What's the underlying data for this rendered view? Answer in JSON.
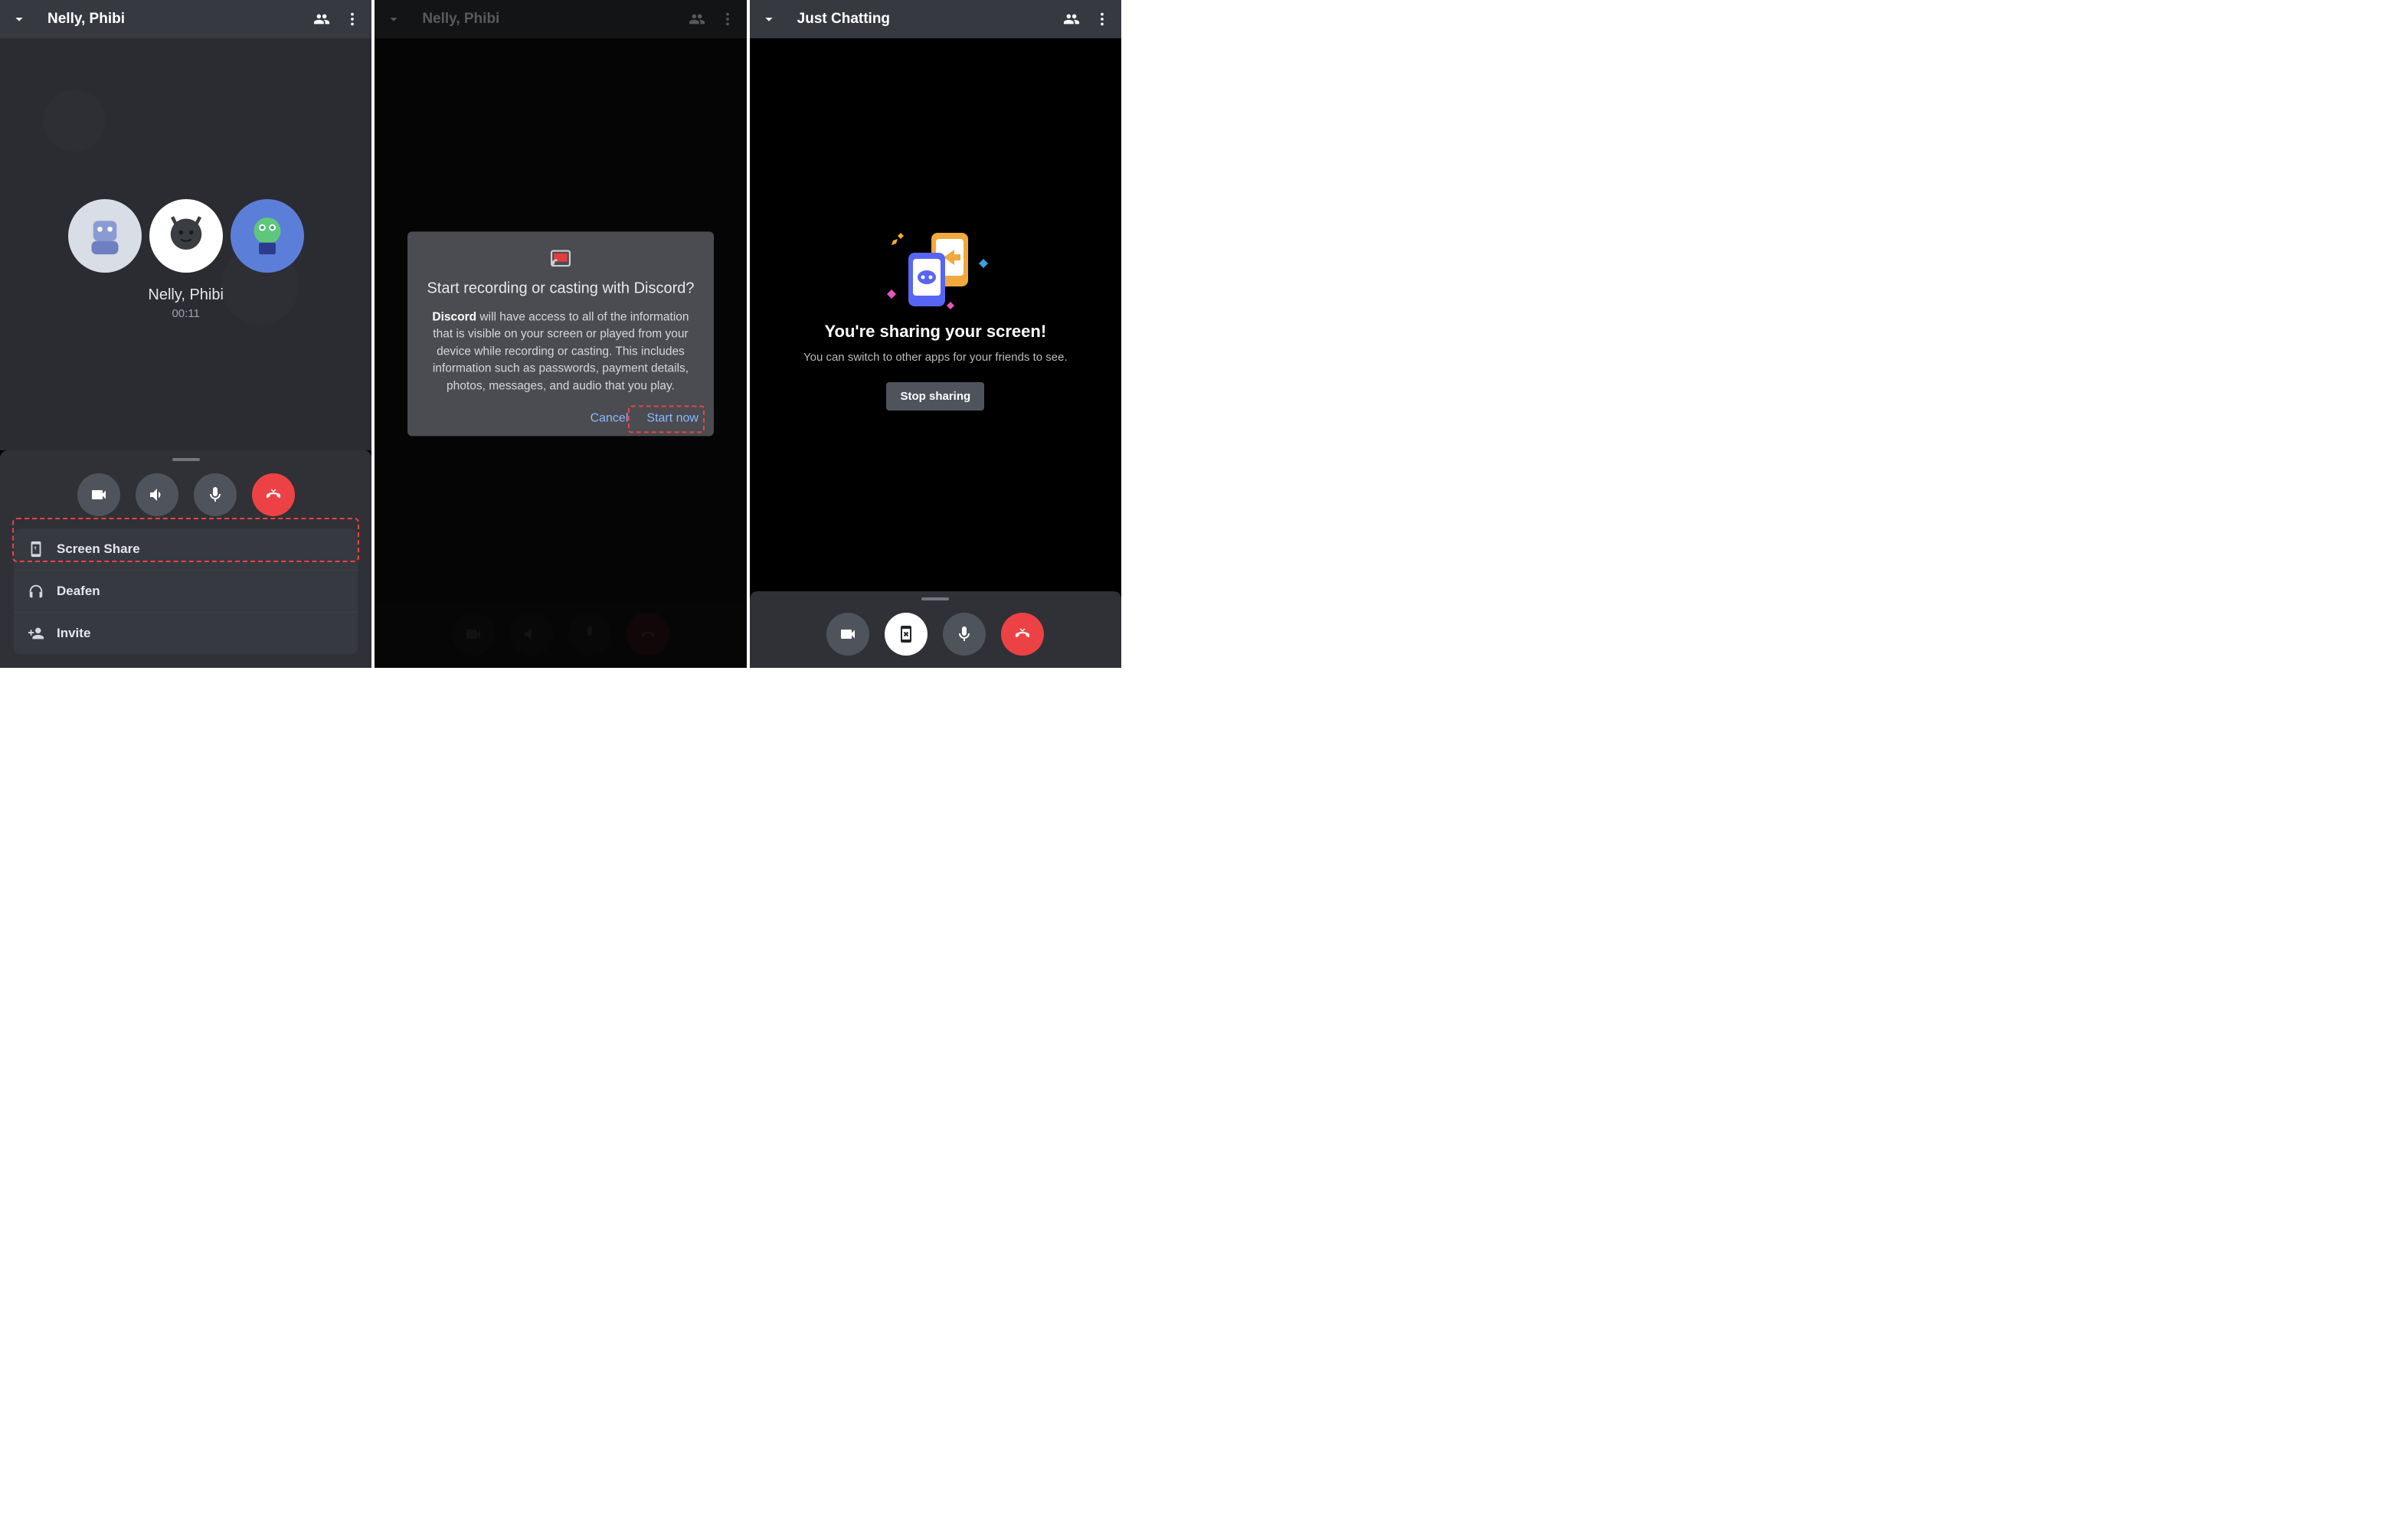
{
  "panel1": {
    "header_title": "Nelly, Phibi",
    "call_label": "Nelly, Phibi",
    "call_timer": "00:11",
    "sheet": {
      "screen_share": "Screen Share",
      "deafen": "Deafen",
      "invite": "Invite"
    }
  },
  "panel2": {
    "header_title": "Nelly, Phibi",
    "dialog": {
      "title": "Start recording or casting with Discord?",
      "body_bold": "Discord",
      "body_rest": " will have access to all of the information that is visible on your screen or played from your device while recording or casting. This includes information such as passwords, payment details, photos, messages, and audio that you play.",
      "cancel": "Cancel",
      "start": "Start now"
    }
  },
  "panel3": {
    "header_title": "Just Chatting",
    "share_title": "You're sharing your screen!",
    "share_sub": "You can switch to other apps for your friends to see.",
    "stop_label": "Stop sharing"
  }
}
